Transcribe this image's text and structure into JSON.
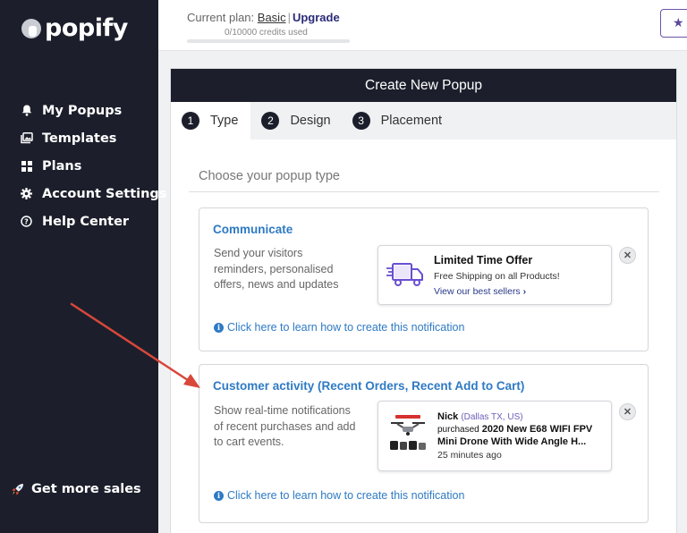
{
  "app": {
    "name": "popify"
  },
  "sidebar": {
    "items": [
      {
        "label": "My Popups",
        "icon": "bell-icon"
      },
      {
        "label": "Templates",
        "icon": "image-gallery-icon"
      },
      {
        "label": "Plans",
        "icon": "grid-icon"
      },
      {
        "label": "Account Settings",
        "icon": "gear-icon"
      },
      {
        "label": "Help Center",
        "icon": "question-circle-icon"
      }
    ],
    "footer": {
      "label": "Get more sales",
      "icon": "rocket-icon"
    }
  },
  "topbar": {
    "plan_prefix": "Current plan:",
    "plan_name": "Basic",
    "separator": "|",
    "upgrade_label": "Upgrade",
    "credits_text": "0/10000 credits used",
    "credits_used": 0,
    "credits_total": 10000,
    "star_icon": "star-icon"
  },
  "panel": {
    "title": "Create New Popup",
    "tabs": [
      {
        "number": "1",
        "label": "Type",
        "active": true
      },
      {
        "number": "2",
        "label": "Design",
        "active": false
      },
      {
        "number": "3",
        "label": "Placement",
        "active": false
      }
    ],
    "section_title": "Choose your popup type",
    "cards": [
      {
        "title": "Communicate",
        "description": "Send your visitors reminders, personalised offers, news and updates",
        "learn_link": "Click here to learn how to create this notification",
        "preview": {
          "icon": "delivery-truck-icon",
          "title": "Limited Time Offer",
          "subtitle": "Free Shipping on all Products!",
          "link": "View our best sellers",
          "link_icon": "chevron-right-icon"
        }
      },
      {
        "title": "Customer activity (Recent Orders, Recent Add to Cart)",
        "description": "Show real-time notifications of recent purchases and add to cart events.",
        "learn_link": "Click here to learn how to create this notification",
        "preview": {
          "image": "drone-product-image",
          "name": "Nick",
          "location": "(Dallas TX, US)",
          "line1_prefix": "purchased",
          "line1_product": "2020 New E68 WIFI FPV",
          "line2": "Mini Drone With Wide Angle H...",
          "time": "25 minutes ago"
        }
      }
    ]
  },
  "colors": {
    "sidebar_bg": "#1c1f2b",
    "link_blue": "#2e7ac4",
    "upgrade": "#2b2a7a",
    "arrow": "#d9473b",
    "truck_purple": "#6a4fd0"
  }
}
